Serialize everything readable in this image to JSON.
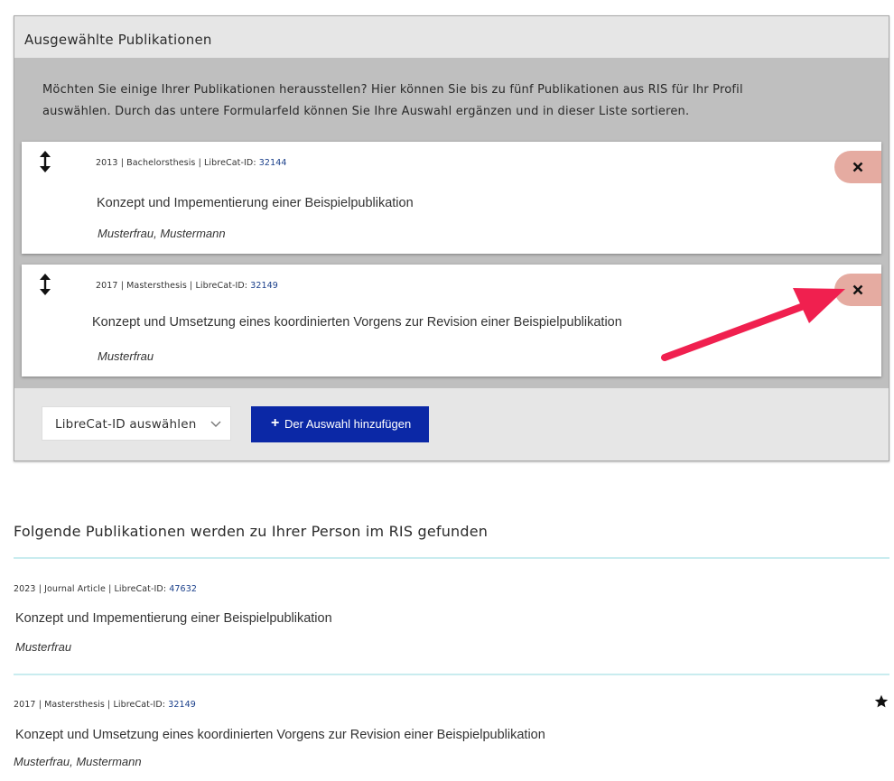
{
  "selected_panel": {
    "title": "Ausgewählte Publikationen",
    "intro": "Möchten Sie einige Ihrer Publikationen herausstellen? Hier können Sie bis zu fünf Publikationen aus RIS für Ihr Profil auswählen. Durch das untere Formularfeld können Sie Ihre Auswahl ergänzen und in dieser Liste sortieren.",
    "items": [
      {
        "meta": "2013 | Bachelorsthesis | LibreCat-ID: ",
        "id": "32144",
        "title": "Konzept und Impementierung einer Beispielpublikation",
        "authors": "Musterfrau, Mustermann",
        "icons": [
          "drag-updown-icon",
          "close-icon"
        ]
      },
      {
        "meta": "2017 | Mastersthesis | LibreCat-ID: ",
        "id": "32149",
        "title": "Konzept und Umsetzung eines koordinierten Vorgens zur Revision einer Beispielpublikation",
        "authors": "Musterfrau",
        "icons": [
          "drag-updown-icon",
          "close-icon"
        ]
      }
    ],
    "select_label": "LibreCat-ID auswählen",
    "add_button_label": "Der Auswahl hinzufügen",
    "add_button_plus": "+",
    "remove_button_color": "#e5aba1",
    "add_button_color": "#0b28a6"
  },
  "annotation": {
    "color": "#f0204f",
    "target": "remove-button-2"
  },
  "found_section": {
    "title": "Folgende Publikationen werden zu Ihrer Person im RIS gefunden",
    "items": [
      {
        "meta": "2023 | Journal Article | LibreCat-ID: ",
        "id": "47632",
        "title": "Konzept und Impementierung einer Beispielpublikation",
        "authors": "Musterfrau"
      },
      {
        "meta": "2017 | Mastersthesis | LibreCat-ID: ",
        "id": "32149",
        "title": "Konzept und Umsetzung eines koordinierten Vorgens zur Revision einer Beispielpublikation",
        "authors": "Musterfrau, Mustermann",
        "icons": [
          "star-icon"
        ]
      }
    ],
    "divider_color": "#c9ecef"
  }
}
